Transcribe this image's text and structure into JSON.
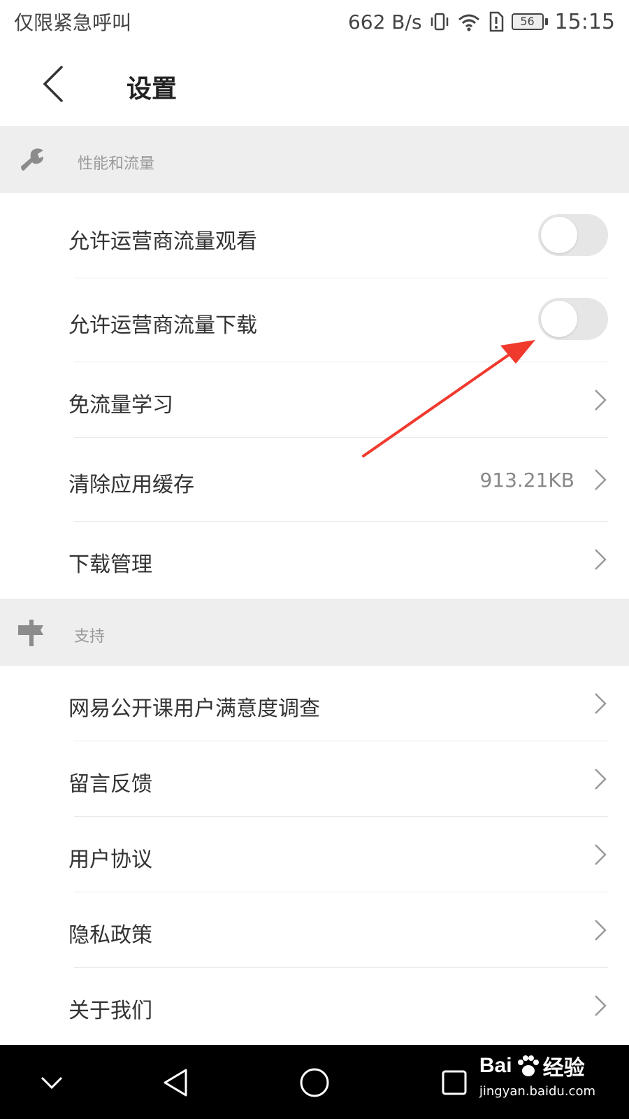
{
  "status_bar": {
    "carrier": "仅限紧急呼叫",
    "speed": "662 B/s",
    "battery": "56",
    "time": "15:15"
  },
  "header": {
    "title": "设置"
  },
  "sections": [
    {
      "label": "性能和流量",
      "icon": "wrench-icon"
    },
    {
      "label": "支持",
      "icon": "signpost-icon"
    }
  ],
  "performance_items": [
    {
      "label": "允许运营商流量观看",
      "toggle_on": false
    },
    {
      "label": "允许运营商流量下载",
      "toggle_on": false
    },
    {
      "label": "免流量学习"
    },
    {
      "label": "清除应用缓存",
      "value": "913.21KB"
    },
    {
      "label": "下载管理"
    }
  ],
  "support_items": [
    {
      "label": "网易公开课用户满意度调查"
    },
    {
      "label": "留言反馈"
    },
    {
      "label": "用户协议"
    },
    {
      "label": "隐私政策"
    },
    {
      "label": "关于我们"
    }
  ],
  "watermark": {
    "brand_left": "Bai",
    "brand_right": "经验",
    "url": "jingyan.baidu.com"
  },
  "colors": {
    "section_bg": "#eeeeee",
    "toggle_off": "#e6e6e6",
    "annotation_arrow": "#f03a2e",
    "navbar_bg": "#000000"
  }
}
